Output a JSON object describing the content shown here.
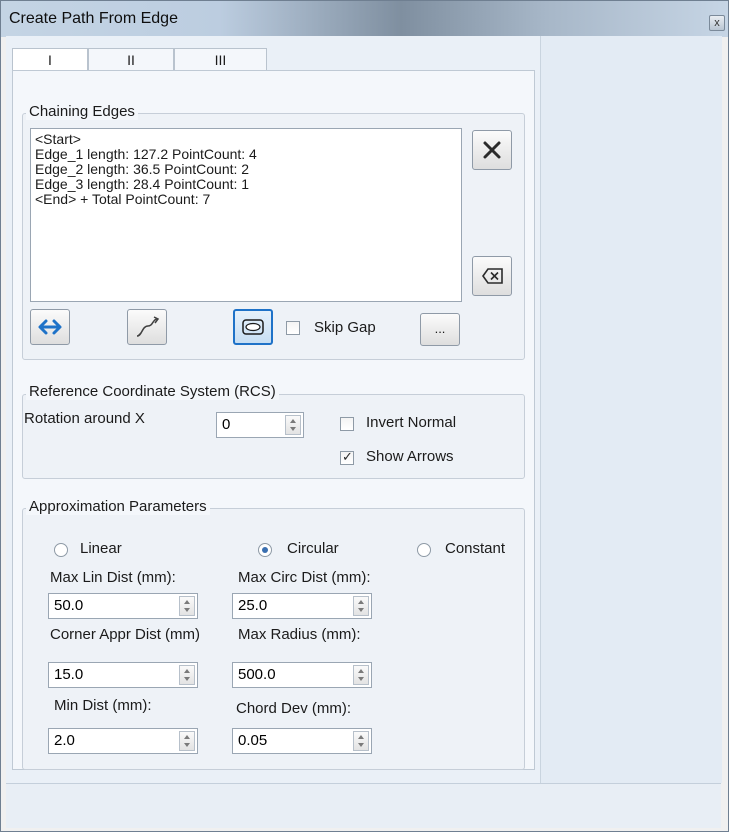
{
  "window": {
    "title": "Create Path From Edge",
    "close_glyph": "x"
  },
  "tabs": [
    {
      "label": "I"
    },
    {
      "label": "II"
    },
    {
      "label": "III"
    }
  ],
  "chaining": {
    "label": "Chaining Edges",
    "items": [
      "<Start>",
      "Edge_1 length: 127.2 PointCount: 4",
      "Edge_2 length: 36.5 PointCount: 2",
      "Edge_3 length: 28.4 PointCount: 1",
      "<End> + Total PointCount: 7"
    ],
    "skip_gap_label": "Skip Gap",
    "skip_gap_checked": false,
    "more_label": "..."
  },
  "rcs": {
    "label": "Reference Coordinate System (RCS)",
    "rotation_label": "Rotation around X",
    "rotation_value": "0",
    "invert_normal_label": "Invert Normal",
    "invert_normal_checked": false,
    "show_arrows_label": "Show Arrows",
    "show_arrows_checked": true
  },
  "approx": {
    "label": "Approximation Parameters",
    "modes": [
      {
        "label": "Linear"
      },
      {
        "label": "Circular"
      },
      {
        "label": "Constant"
      }
    ],
    "selected_mode": "Circular",
    "max_lin_dist": {
      "label": "Max Lin Dist (mm):",
      "value": "50.0"
    },
    "corner_appr_dist": {
      "label": "Corner Appr Dist (mm)",
      "value": "15.0"
    },
    "min_dist": {
      "label": "Min Dist (mm):",
      "value": "2.0"
    },
    "max_circ_dist": {
      "label": "Max Circ Dist (mm):",
      "value": "25.0"
    },
    "max_radius": {
      "label": "Max Radius (mm):",
      "value": "500.0"
    },
    "chord_dev": {
      "label": "Chord Dev (mm):",
      "value": "0.05"
    }
  },
  "colors": {
    "accent": "#1e72c8",
    "selection": "#3a6fb0"
  }
}
